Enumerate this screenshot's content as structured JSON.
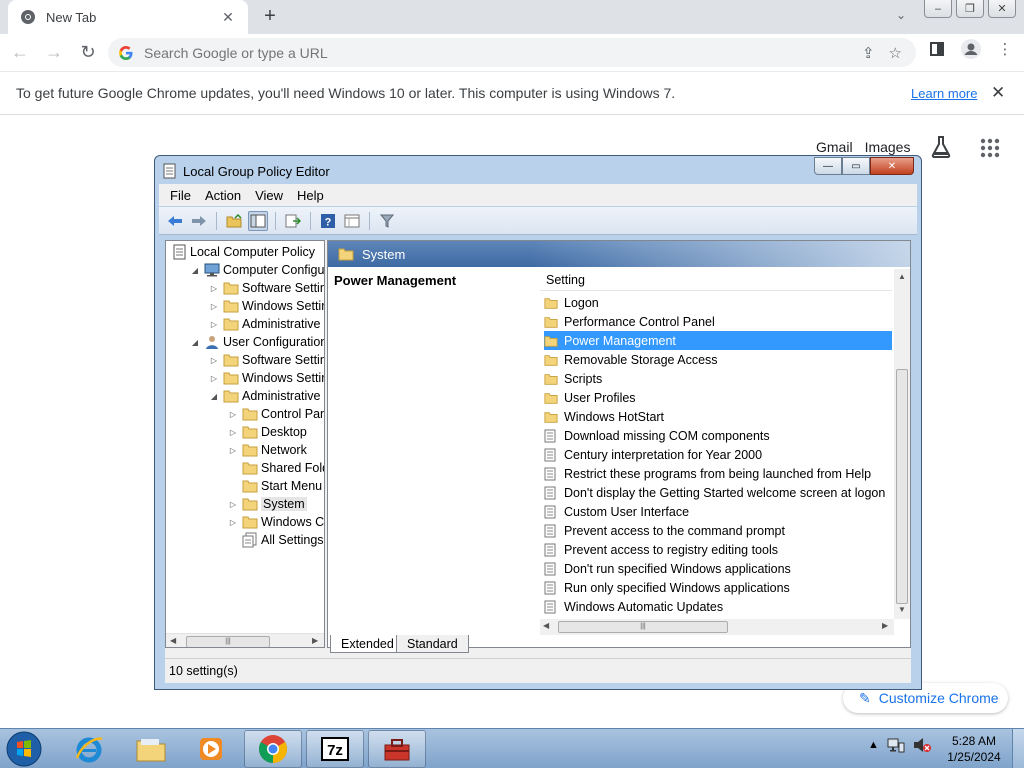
{
  "browser": {
    "tab_title": "New Tab",
    "omnibox_placeholder": "Search Google or type a URL",
    "infobar_message": "To get future Google Chrome updates, you'll need Windows 10 or later. This computer is using Windows 7.",
    "infobar_link": "Learn more",
    "ntp_links": [
      "Gmail",
      "Images"
    ],
    "customize_label": "Customize Chrome"
  },
  "gpedit": {
    "title": "Local Group Policy Editor",
    "menu": [
      "File",
      "Action",
      "View",
      "Help"
    ],
    "tree": [
      {
        "label": "Local Computer Policy",
        "level": 0,
        "expander": "",
        "icon": "policy"
      },
      {
        "label": "Computer Configura",
        "level": 1,
        "expander": "open",
        "icon": "computer"
      },
      {
        "label": "Software Settings",
        "level": 2,
        "expander": "closed",
        "icon": "folder"
      },
      {
        "label": "Windows Setting",
        "level": 2,
        "expander": "closed",
        "icon": "folder"
      },
      {
        "label": "Administrative Te",
        "level": 2,
        "expander": "closed",
        "icon": "folder"
      },
      {
        "label": "User Configuration",
        "level": 1,
        "expander": "open",
        "icon": "user"
      },
      {
        "label": "Software Settings",
        "level": 2,
        "expander": "closed",
        "icon": "folder"
      },
      {
        "label": "Windows Setting",
        "level": 2,
        "expander": "closed",
        "icon": "folder"
      },
      {
        "label": "Administrative Te",
        "level": 2,
        "expander": "open",
        "icon": "folder"
      },
      {
        "label": "Control Panel",
        "level": 3,
        "expander": "closed",
        "icon": "folder"
      },
      {
        "label": "Desktop",
        "level": 3,
        "expander": "closed",
        "icon": "folder"
      },
      {
        "label": "Network",
        "level": 3,
        "expander": "closed",
        "icon": "folder"
      },
      {
        "label": "Shared Folder",
        "level": 3,
        "expander": "",
        "icon": "folder"
      },
      {
        "label": "Start Menu ar",
        "level": 3,
        "expander": "",
        "icon": "folder"
      },
      {
        "label": "System",
        "level": 3,
        "expander": "closed",
        "icon": "folder",
        "selected": true
      },
      {
        "label": "Windows Cor",
        "level": 3,
        "expander": "closed",
        "icon": "folder"
      },
      {
        "label": "All Settings",
        "level": 3,
        "expander": "",
        "icon": "allsettings"
      }
    ],
    "panel_header": "System",
    "extended_title": "Power Management",
    "column_header": "Setting",
    "items": [
      {
        "label": "Logon",
        "type": "folder"
      },
      {
        "label": "Performance Control Panel",
        "type": "folder"
      },
      {
        "label": "Power Management",
        "type": "folder",
        "selected": true
      },
      {
        "label": "Removable Storage Access",
        "type": "folder"
      },
      {
        "label": "Scripts",
        "type": "folder"
      },
      {
        "label": "User Profiles",
        "type": "folder"
      },
      {
        "label": "Windows HotStart",
        "type": "folder"
      },
      {
        "label": "Download missing COM components",
        "type": "setting"
      },
      {
        "label": "Century interpretation for Year 2000",
        "type": "setting"
      },
      {
        "label": "Restrict these programs from being launched from Help",
        "type": "setting"
      },
      {
        "label": "Don't display the Getting Started welcome screen at logon",
        "type": "setting"
      },
      {
        "label": "Custom User Interface",
        "type": "setting"
      },
      {
        "label": "Prevent access to the command prompt",
        "type": "setting"
      },
      {
        "label": "Prevent access to registry editing tools",
        "type": "setting"
      },
      {
        "label": "Don't run specified Windows applications",
        "type": "setting"
      },
      {
        "label": "Run only specified Windows applications",
        "type": "setting"
      },
      {
        "label": "Windows Automatic Updates",
        "type": "setting"
      }
    ],
    "tabs": [
      "Extended",
      "Standard"
    ],
    "status": "10 setting(s)"
  },
  "taskbar": {
    "time": "5:28 AM",
    "date": "1/25/2024",
    "apps": [
      "internet-explorer",
      "file-explorer",
      "media-player",
      "chrome",
      "7zip",
      "toolbox"
    ]
  },
  "colors": {
    "selection": "#3399ff",
    "link": "#1a73e8",
    "panel_header": "#3d6aa4"
  }
}
